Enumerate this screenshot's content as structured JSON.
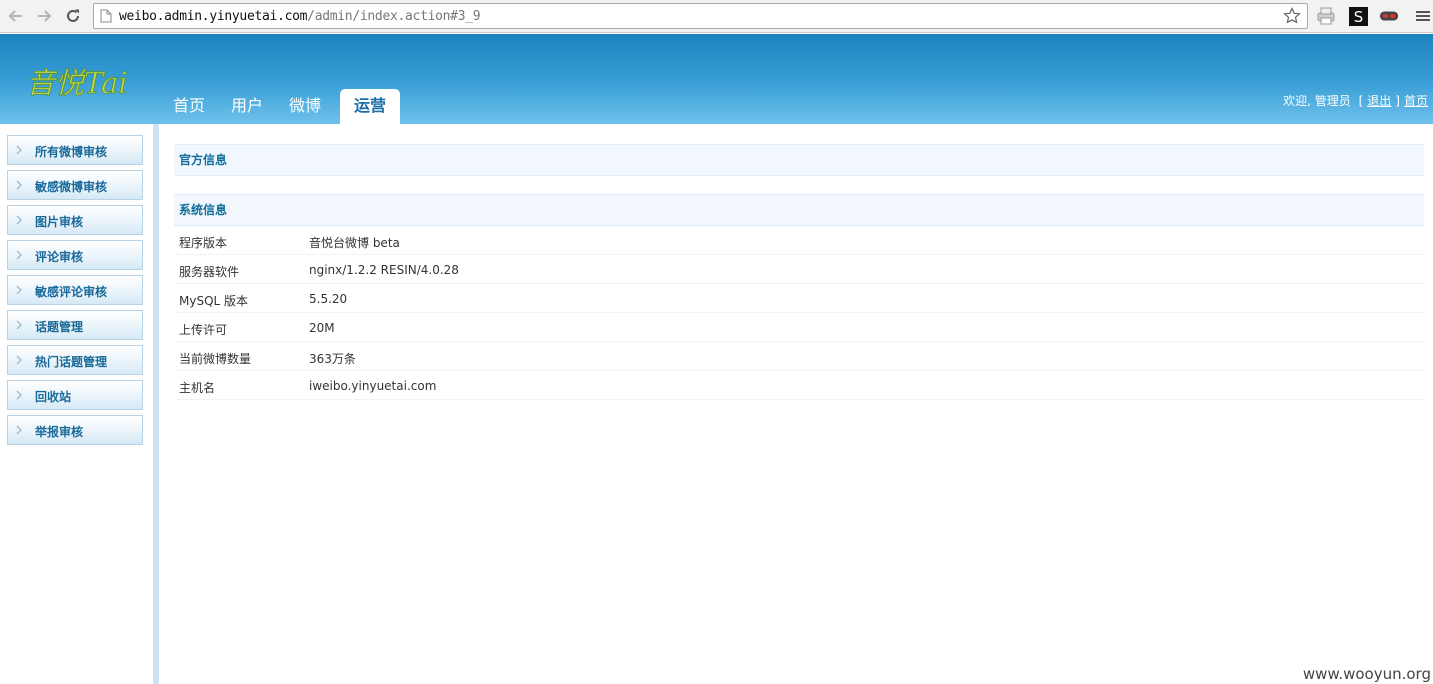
{
  "browser": {
    "url_host": "weibo.admin.yinyuetai.com",
    "url_path": "/admin/index.action#3_9"
  },
  "header": {
    "logo_text": "音悦Tai",
    "nav": [
      {
        "label": "首页",
        "active": false
      },
      {
        "label": "用户",
        "active": false
      },
      {
        "label": "微博",
        "active": false
      },
      {
        "label": "运营",
        "active": true
      }
    ],
    "user": {
      "welcome": "欢迎, 管理员",
      "bracket_open": "[",
      "logout": "退出",
      "bracket_close": "]",
      "home": "首页"
    }
  },
  "sidebar": {
    "items": [
      {
        "label": "所有微博审核"
      },
      {
        "label": "敏感微博审核"
      },
      {
        "label": "图片审核"
      },
      {
        "label": "评论审核"
      },
      {
        "label": "敏感评论审核"
      },
      {
        "label": "话题管理"
      },
      {
        "label": "热门话题管理"
      },
      {
        "label": "回收站"
      },
      {
        "label": "举报审核"
      }
    ]
  },
  "main": {
    "official_title": "官方信息",
    "system_title": "系统信息",
    "system_rows": [
      {
        "key": "程序版本",
        "value": "音悦台微博 beta"
      },
      {
        "key": "服务器软件",
        "value": "nginx/1.2.2 RESIN/4.0.28"
      },
      {
        "key": "MySQL 版本",
        "value": "5.5.20"
      },
      {
        "key": "上传许可",
        "value": "20M"
      },
      {
        "key": "当前微博数量",
        "value": "363万条"
      },
      {
        "key": "主机名",
        "value": "iweibo.yinyuetai.com"
      }
    ]
  },
  "watermark": "www.wooyun.org",
  "colors": {
    "header_top": "#1c83bf",
    "header_bottom": "#6fc1ec",
    "section_title": "#0f6f9a",
    "sidebar_label": "#1a6a9a"
  }
}
